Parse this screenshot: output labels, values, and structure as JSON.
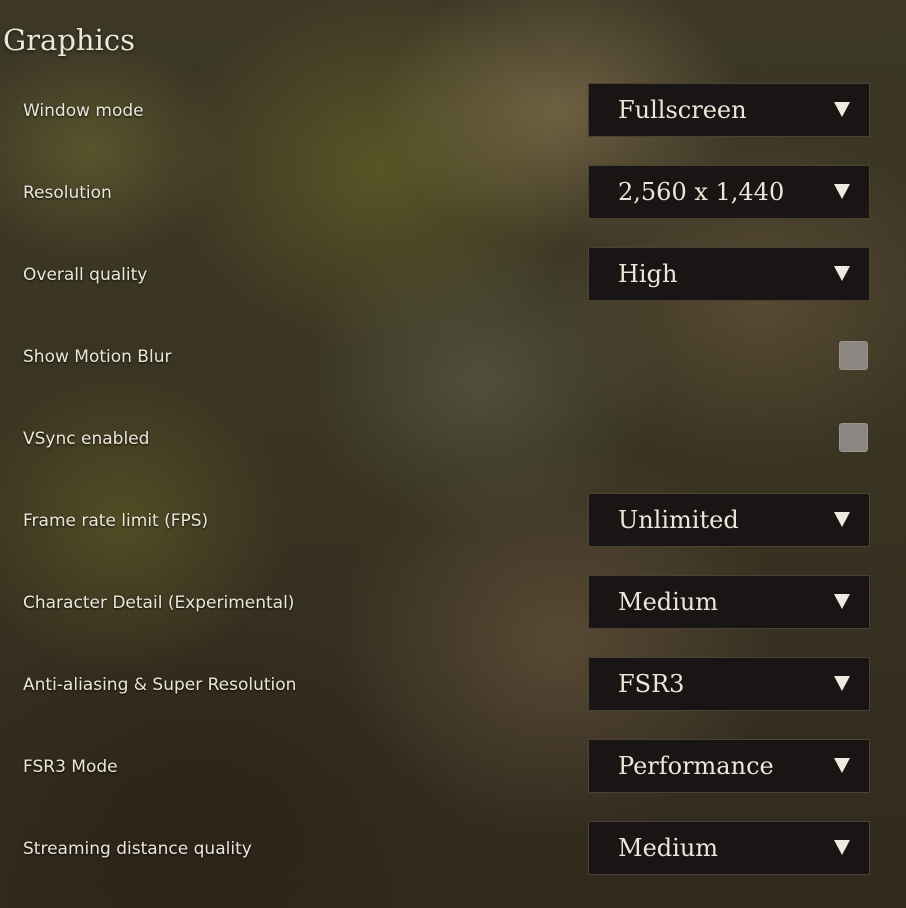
{
  "page_title": "Graphics",
  "settings": {
    "window_mode": {
      "label": "Window mode",
      "value": "Fullscreen",
      "icon": "dropdown-arrow-icon"
    },
    "resolution": {
      "label": "Resolution",
      "value": "2,560 x 1,440",
      "icon": "dropdown-arrow-icon"
    },
    "overall_quality": {
      "label": "Overall quality",
      "value": "High",
      "icon": "dropdown-arrow-icon"
    },
    "motion_blur": {
      "label": "Show Motion Blur",
      "checked": false
    },
    "vsync": {
      "label": "VSync enabled",
      "checked": false
    },
    "frame_rate_limit": {
      "label": "Frame rate limit (FPS)",
      "value": "Unlimited",
      "icon": "dropdown-arrow-icon"
    },
    "character_detail": {
      "label": "Character Detail (Experimental)",
      "value": "Medium",
      "icon": "dropdown-arrow-icon"
    },
    "anti_aliasing": {
      "label": "Anti-aliasing & Super Resolution",
      "value": "FSR3",
      "icon": "dropdown-arrow-icon"
    },
    "fsr3_mode": {
      "label": "FSR3 Mode",
      "value": "Performance",
      "icon": "dropdown-arrow-icon"
    },
    "streaming_distance": {
      "label": "Streaming distance quality",
      "value": "Medium",
      "icon": "dropdown-arrow-icon"
    }
  },
  "colors": {
    "dropdown_background": "#181514",
    "dropdown_border": "#4a4235",
    "checkbox_fill": "#8b8681",
    "text": "#ebe6da"
  }
}
